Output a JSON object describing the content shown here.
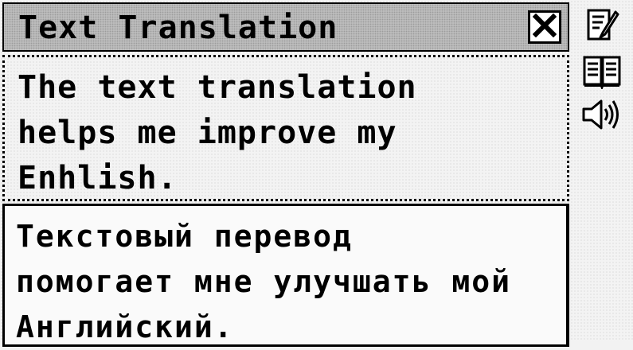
{
  "window": {
    "title": "Text Translation"
  },
  "source": {
    "text": "The text translation\nhelps me improve my\nEnhlish."
  },
  "translation": {
    "text": "Текстовый перевод\nпомогает мне улучшать мой\nАнглийский."
  },
  "toolbar": {
    "buttons": [
      {
        "icon": "edit-note-icon"
      },
      {
        "icon": "book-icon"
      },
      {
        "icon": "speaker-icon"
      }
    ]
  },
  "icons": {
    "close": "close-icon"
  }
}
